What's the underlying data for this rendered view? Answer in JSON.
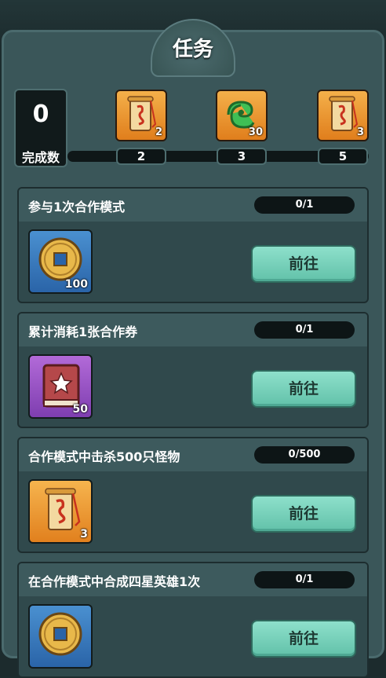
{
  "header": {
    "title": "任务"
  },
  "completion": {
    "count": "0",
    "label": "完成数"
  },
  "milestones": [
    {
      "icon": "scroll-icon",
      "quantity": "2",
      "threshold": "2"
    },
    {
      "icon": "jade-icon",
      "quantity": "30",
      "threshold": "3"
    },
    {
      "icon": "scroll-icon",
      "quantity": "3",
      "threshold": "5"
    }
  ],
  "tasks": [
    {
      "title": "参与1次合作模式",
      "progress": "0/1",
      "reward_icon": "coin-icon",
      "reward_qty": "100",
      "button": "前往"
    },
    {
      "title": "累计消耗1张合作券",
      "progress": "0/1",
      "reward_icon": "book-icon",
      "reward_qty": "50",
      "button": "前往"
    },
    {
      "title": "合作模式中击杀500只怪物",
      "progress": "0/500",
      "reward_icon": "scroll-icon",
      "reward_qty": "3",
      "button": "前往"
    },
    {
      "title": "在合作模式中合成四星英雄1次",
      "progress": "0/1",
      "reward_icon": "coin-icon",
      "reward_qty": "",
      "button": "前往"
    }
  ],
  "colors": {
    "panel": "#3a5659",
    "button": "#7ad3bc",
    "track": "#0f1718"
  }
}
